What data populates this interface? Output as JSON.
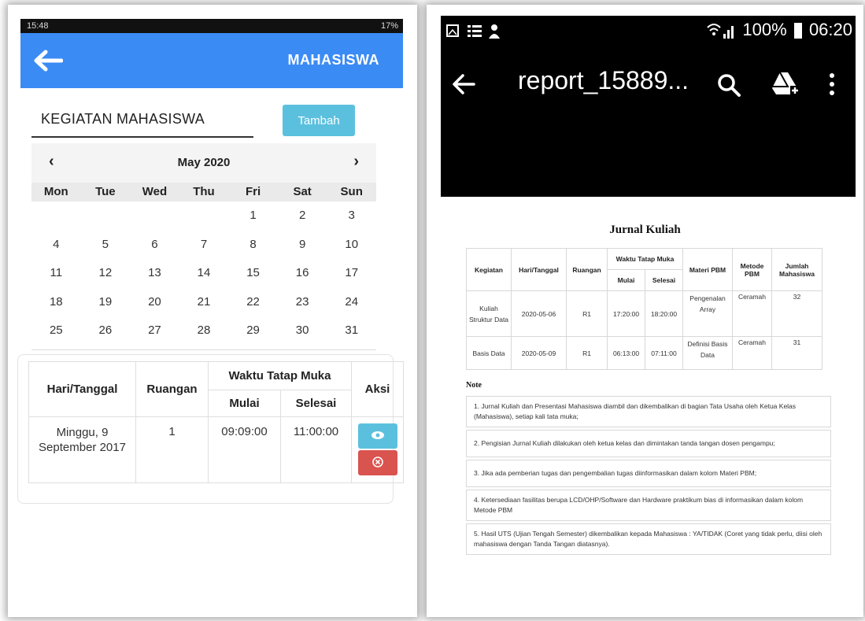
{
  "left": {
    "status_time": "15:48",
    "status_battery": "17%",
    "appbar_title": "MAHASISWA",
    "section_title": "KEGIATAN MAHASISWA",
    "add_button": "Tambah",
    "calendar": {
      "month": "May 2020",
      "prev": "‹",
      "next": "›",
      "weekdays": [
        "Mon",
        "Tue",
        "Wed",
        "Thu",
        "Fri",
        "Sat",
        "Sun"
      ],
      "days": [
        "",
        "",
        "",
        "",
        "1",
        "2",
        "3",
        "4",
        "5",
        "6",
        "7",
        "8",
        "9",
        "10",
        "11",
        "12",
        "13",
        "14",
        "15",
        "16",
        "17",
        "18",
        "19",
        "20",
        "21",
        "22",
        "23",
        "24",
        "25",
        "26",
        "27",
        "28",
        "29",
        "30",
        "31"
      ]
    },
    "table": {
      "headers": {
        "date": "Hari/Tanggal",
        "room": "Ruangan",
        "time": "Waktu Tatap Muka",
        "start": "Mulai",
        "end": "Selesai",
        "action": "Aksi"
      },
      "row": {
        "date": "Minggu, 9 September 2017",
        "room": "1",
        "start": "09:09:00",
        "end": "11:00:00"
      }
    }
  },
  "right": {
    "status_battery": "100%",
    "status_time": "06:20",
    "report_title": "report_15889...",
    "doc_title": "Jurnal Kuliah",
    "doc_headers": {
      "kegiatan": "Kegiatan",
      "hari": "Hari/Tanggal",
      "ruangan": "Ruangan",
      "waktu": "Waktu Tatap Muka",
      "mulai": "Mulai",
      "selesai": "Selesai",
      "materi": "Materi PBM",
      "metode": "Metode PBM",
      "jumlah": "Jumlah Mahasiswa"
    },
    "doc_rows": [
      {
        "kegiatan": "Kuliah Struktur Data",
        "hari": "2020-05-06",
        "ruangan": "R1",
        "mulai": "17:20:00",
        "selesai": "18:20:00",
        "materi": "Pengenalan Array",
        "metode": "Ceramah",
        "jumlah": "32"
      },
      {
        "kegiatan": "Basis Data",
        "hari": "2020-05-09",
        "ruangan": "R1",
        "mulai": "06:13:00",
        "selesai": "07:11:00",
        "materi": "Definisi Basis Data",
        "metode": "Ceramah",
        "jumlah": "31"
      }
    ],
    "note_label": "Note",
    "notes": [
      "1. Jurnal Kuliah dan Presentasi Mahasiswa diambil dan dikembalikan di bagian Tata Usaha oleh Ketua Kelas (Mahasiswa), setiap kali tata muka;",
      "2. Pengisian Jurnal Kuliah dilakukan oleh ketua kelas dan dimintakan tanda tangan dosen pengampu;",
      "3. Jika ada pemberian tugas dan pengembalian tugas diinformasikan dalam kolom Materi PBM;",
      "4. Ketersediaan fasilitas berupa LCD/OHP/Software dan Hardware praktikum bias di informasikan dalam kolom Metode PBM",
      "5. Hasil UTS (Ujian Tengah Semester) dikembalikan kepada Mahasiswa : YA/TIDAK (Coret yang tidak perlu, diisi oleh mahasiswa dengan Tanda Tangan diatasnya)."
    ]
  }
}
